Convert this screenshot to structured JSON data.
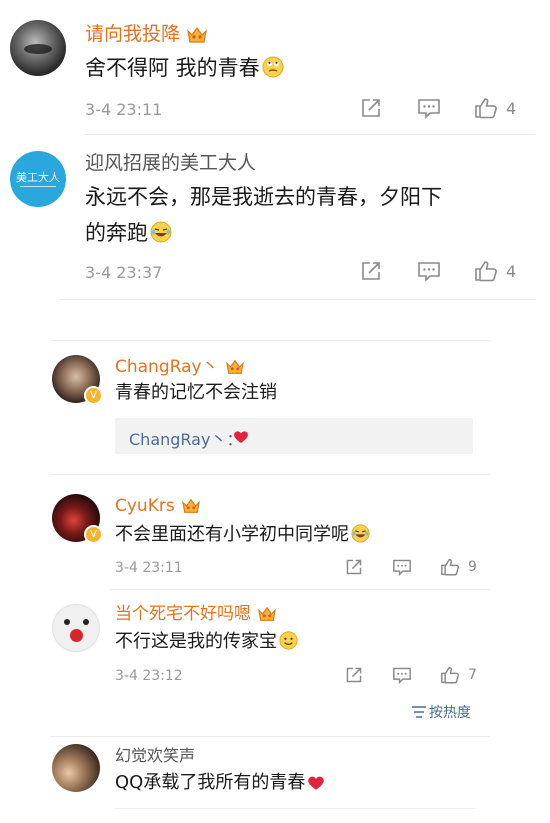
{
  "comments": [
    {
      "user": "请向我投降",
      "text": "舍不得阿 我的青春",
      "time": "3-4 23:11",
      "likes": "4"
    },
    {
      "user": "迎风招展的美工大人",
      "avatar_text": "美工大人",
      "text_line1": "永远不会，那是我逝去的青春，夕阳下",
      "text_line2": "的奔跑",
      "time": "3-4 23:37",
      "likes": "4"
    }
  ],
  "replies": [
    {
      "user": "ChangRay丶",
      "text": "青春的记忆不会注销",
      "quote_user": "ChangRay丶：",
      "time": ""
    },
    {
      "user": "CyuKrs",
      "text": "不会里面还有小学初中同学呢",
      "time": "3-4 23:11",
      "likes": "9"
    },
    {
      "user": "当个死宅不好吗嗯",
      "text": "不行这是我的传家宝",
      "time": "3-4 23:12",
      "likes": "7"
    },
    {
      "user": "幻觉欢笑声",
      "text": "QQ承载了我所有的青春"
    }
  ],
  "sort_label": "按热度",
  "colors": {
    "username_orange": "#e8711f",
    "username_plain": "#555555",
    "heart": "#e0243a",
    "quote_bg": "#f2f2f2",
    "link_blue": "#4a6d9a"
  }
}
